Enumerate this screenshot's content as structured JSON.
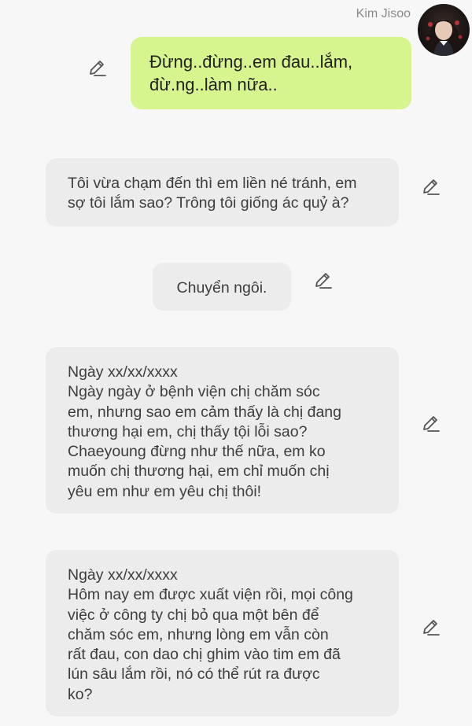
{
  "user": {
    "name": "Kim Jisoo",
    "message_lines": [
      "Đừng..đừng..em đau..lắm,",
      "đừ.ng..làm nữa.."
    ]
  },
  "messages": [
    {
      "lines": [
        "Tôi vừa chạm đến thì em liền né tránh, em",
        "sợ tôi lắm sao? Trông tôi giống ác quỷ à?"
      ]
    },
    {
      "lines": [
        "Chuyển ngôi."
      ]
    },
    {
      "lines": [
        "Ngày xx/xx/xxxx",
        "Ngày ngày ở bệnh viện chị chăm sóc",
        "em, nhưng sao em cảm thấy là chị đang",
        "thương hại em, chị thấy tội lỗi sao?",
        "Chaeyoung đừng như thế nữa, em ko",
        "muốn chị thương hại, em chỉ muốn chị",
        "yêu em như em yêu chị thôi!"
      ]
    },
    {
      "lines": [
        "Ngày xx/xx/xxxx",
        "Hôm nay em được xuất viện rồi, mọi công",
        "việc ở công ty chị bỏ qua một bên để",
        "chăm sóc em, nhưng lòng em vẫn còn",
        "rất đau, con dao chị ghim vào tim em đã",
        "lún sâu lắm rồi, nó có thể rút ra được",
        "ko?"
      ]
    }
  ],
  "icons": {
    "edit": "pencil-icon"
  },
  "colors": {
    "background": "#f7f7f7",
    "user_bubble": "#d6f58f",
    "ai_bubble": "#ececec",
    "name_text": "#8a8a8a"
  }
}
